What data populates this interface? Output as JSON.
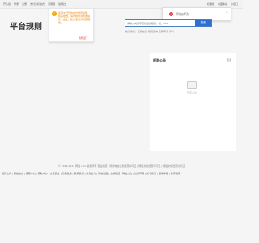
{
  "topbar": {
    "items": [
      "开心窗",
      "登录",
      "注册",
      "支付及标格式",
      "有限规",
      "加规社"
    ],
    "right": [
      "标准版",
      "收藏本站",
      "小窗口"
    ]
  },
  "tip": {
    "icon": "warning-icon",
    "text": "您需文已开启站长端风格量，如需更改，请你启动浏览器插件，由此，建议使用浏览器辅助。",
    "link": "我知道了"
  },
  "notice": {
    "text": "添加成功",
    "close": "×"
  },
  "page_title": "平台规则",
  "search": {
    "placeholder": "请输入关键字查找您的疑问，如：xxx",
    "button": "搜索"
  },
  "hot": "热门搜索：违规处罚 规则咨询 违规申诉 评价",
  "panel": {
    "title": "规则公告",
    "more": "更多",
    "empty": "暂无公告"
  },
  "footer": {
    "line1": "© 2016-2022 网站.com 版权所有 营业执照 | 增值电信业务经营许可证 | 网络文化经营许可证 | 网络文化经营许可证",
    "line2": "规则支持 | 网站动态 | 客服中心 | 帮助中心 | 交易安全 | 隐私政策 | 联系我们 | 商务合作 | 网站地图 | 友情链接 | 网站公告 | 法律声明 | 关于我们 | 违规举报 | 新手指南"
  }
}
